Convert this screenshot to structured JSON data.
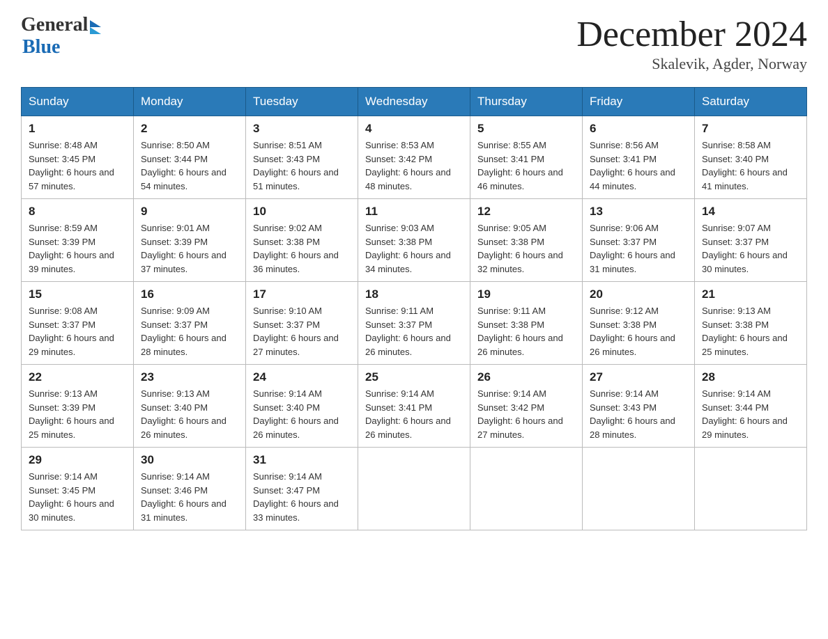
{
  "header": {
    "logo_general": "General",
    "logo_blue": "Blue",
    "title": "December 2024",
    "location": "Skalevik, Agder, Norway"
  },
  "weekdays": [
    "Sunday",
    "Monday",
    "Tuesday",
    "Wednesday",
    "Thursday",
    "Friday",
    "Saturday"
  ],
  "weeks": [
    [
      {
        "day": "1",
        "sunrise": "8:48 AM",
        "sunset": "3:45 PM",
        "daylight": "6 hours and 57 minutes."
      },
      {
        "day": "2",
        "sunrise": "8:50 AM",
        "sunset": "3:44 PM",
        "daylight": "6 hours and 54 minutes."
      },
      {
        "day": "3",
        "sunrise": "8:51 AM",
        "sunset": "3:43 PM",
        "daylight": "6 hours and 51 minutes."
      },
      {
        "day": "4",
        "sunrise": "8:53 AM",
        "sunset": "3:42 PM",
        "daylight": "6 hours and 48 minutes."
      },
      {
        "day": "5",
        "sunrise": "8:55 AM",
        "sunset": "3:41 PM",
        "daylight": "6 hours and 46 minutes."
      },
      {
        "day": "6",
        "sunrise": "8:56 AM",
        "sunset": "3:41 PM",
        "daylight": "6 hours and 44 minutes."
      },
      {
        "day": "7",
        "sunrise": "8:58 AM",
        "sunset": "3:40 PM",
        "daylight": "6 hours and 41 minutes."
      }
    ],
    [
      {
        "day": "8",
        "sunrise": "8:59 AM",
        "sunset": "3:39 PM",
        "daylight": "6 hours and 39 minutes."
      },
      {
        "day": "9",
        "sunrise": "9:01 AM",
        "sunset": "3:39 PM",
        "daylight": "6 hours and 37 minutes."
      },
      {
        "day": "10",
        "sunrise": "9:02 AM",
        "sunset": "3:38 PM",
        "daylight": "6 hours and 36 minutes."
      },
      {
        "day": "11",
        "sunrise": "9:03 AM",
        "sunset": "3:38 PM",
        "daylight": "6 hours and 34 minutes."
      },
      {
        "day": "12",
        "sunrise": "9:05 AM",
        "sunset": "3:38 PM",
        "daylight": "6 hours and 32 minutes."
      },
      {
        "day": "13",
        "sunrise": "9:06 AM",
        "sunset": "3:37 PM",
        "daylight": "6 hours and 31 minutes."
      },
      {
        "day": "14",
        "sunrise": "9:07 AM",
        "sunset": "3:37 PM",
        "daylight": "6 hours and 30 minutes."
      }
    ],
    [
      {
        "day": "15",
        "sunrise": "9:08 AM",
        "sunset": "3:37 PM",
        "daylight": "6 hours and 29 minutes."
      },
      {
        "day": "16",
        "sunrise": "9:09 AM",
        "sunset": "3:37 PM",
        "daylight": "6 hours and 28 minutes."
      },
      {
        "day": "17",
        "sunrise": "9:10 AM",
        "sunset": "3:37 PM",
        "daylight": "6 hours and 27 minutes."
      },
      {
        "day": "18",
        "sunrise": "9:11 AM",
        "sunset": "3:37 PM",
        "daylight": "6 hours and 26 minutes."
      },
      {
        "day": "19",
        "sunrise": "9:11 AM",
        "sunset": "3:38 PM",
        "daylight": "6 hours and 26 minutes."
      },
      {
        "day": "20",
        "sunrise": "9:12 AM",
        "sunset": "3:38 PM",
        "daylight": "6 hours and 26 minutes."
      },
      {
        "day": "21",
        "sunrise": "9:13 AM",
        "sunset": "3:38 PM",
        "daylight": "6 hours and 25 minutes."
      }
    ],
    [
      {
        "day": "22",
        "sunrise": "9:13 AM",
        "sunset": "3:39 PM",
        "daylight": "6 hours and 25 minutes."
      },
      {
        "day": "23",
        "sunrise": "9:13 AM",
        "sunset": "3:40 PM",
        "daylight": "6 hours and 26 minutes."
      },
      {
        "day": "24",
        "sunrise": "9:14 AM",
        "sunset": "3:40 PM",
        "daylight": "6 hours and 26 minutes."
      },
      {
        "day": "25",
        "sunrise": "9:14 AM",
        "sunset": "3:41 PM",
        "daylight": "6 hours and 26 minutes."
      },
      {
        "day": "26",
        "sunrise": "9:14 AM",
        "sunset": "3:42 PM",
        "daylight": "6 hours and 27 minutes."
      },
      {
        "day": "27",
        "sunrise": "9:14 AM",
        "sunset": "3:43 PM",
        "daylight": "6 hours and 28 minutes."
      },
      {
        "day": "28",
        "sunrise": "9:14 AM",
        "sunset": "3:44 PM",
        "daylight": "6 hours and 29 minutes."
      }
    ],
    [
      {
        "day": "29",
        "sunrise": "9:14 AM",
        "sunset": "3:45 PM",
        "daylight": "6 hours and 30 minutes."
      },
      {
        "day": "30",
        "sunrise": "9:14 AM",
        "sunset": "3:46 PM",
        "daylight": "6 hours and 31 minutes."
      },
      {
        "day": "31",
        "sunrise": "9:14 AM",
        "sunset": "3:47 PM",
        "daylight": "6 hours and 33 minutes."
      },
      null,
      null,
      null,
      null
    ]
  ]
}
